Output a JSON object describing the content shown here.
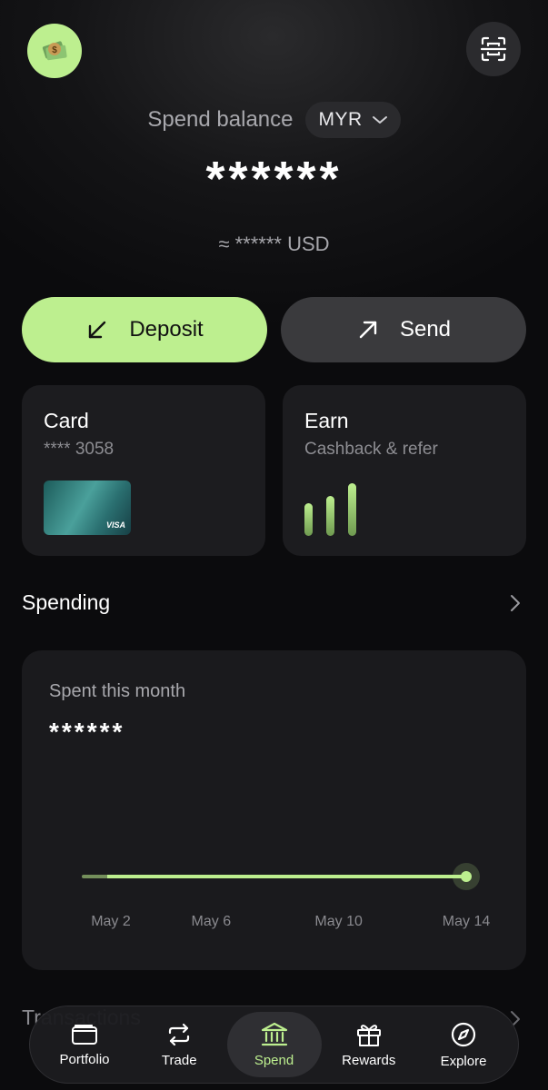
{
  "header": {
    "avatar_icon": "money-bag-emoji",
    "scan_icon": "scan-icon"
  },
  "balance": {
    "label": "Spend balance",
    "currency": "MYR",
    "value": "******",
    "usd_value": "≈ ****** USD"
  },
  "actions": {
    "deposit_label": "Deposit",
    "send_label": "Send"
  },
  "tiles": {
    "card": {
      "title": "Card",
      "subtitle": "**** 3058",
      "card_brand": "VISA"
    },
    "earn": {
      "title": "Earn",
      "subtitle": "Cashback & refer"
    }
  },
  "spending": {
    "title": "Spending",
    "spent_label": "Spent this month",
    "spent_value": "******"
  },
  "chart_data": {
    "type": "line",
    "x": [
      "May 2",
      "May 6",
      "May 10",
      "May 14"
    ],
    "ticks": [
      "May 2",
      "May 6",
      "May 10",
      "May 14"
    ],
    "series": [
      {
        "values": [
          0,
          0,
          0,
          0
        ]
      }
    ],
    "grid": false,
    "xlabel": "",
    "ylabel": ""
  },
  "transactions": {
    "title": "Transactions"
  },
  "nav": {
    "items": [
      {
        "label": "Portfolio",
        "icon": "wallet-icon"
      },
      {
        "label": "Trade",
        "icon": "swap-icon"
      },
      {
        "label": "Spend",
        "icon": "bank-icon",
        "active": true
      },
      {
        "label": "Rewards",
        "icon": "gift-icon"
      },
      {
        "label": "Explore",
        "icon": "compass-icon"
      }
    ]
  },
  "colors": {
    "accent": "#bdef8f",
    "background": "#0b0b0d",
    "surface": "#1c1c1f"
  }
}
